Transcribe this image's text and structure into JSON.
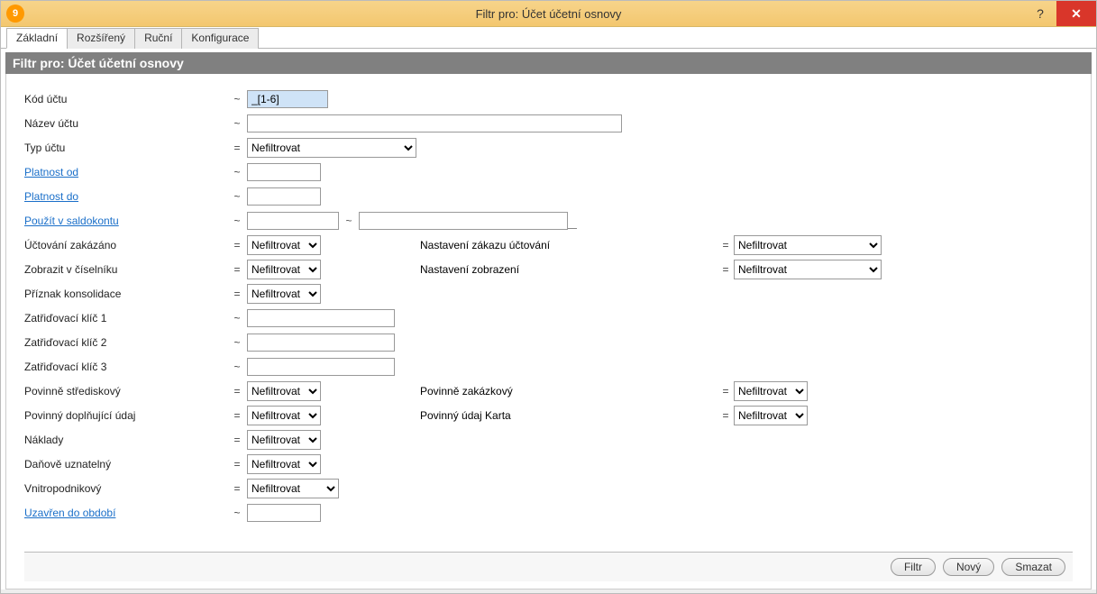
{
  "window": {
    "title": "Filtr pro: Účet účetní osnovy",
    "icon_char": "9"
  },
  "tabs": [
    "Základní",
    "Rozšířený",
    "Ruční",
    "Konfigurace"
  ],
  "active_tab": 0,
  "panel_title": "Filtr pro: Účet účetní osnovy",
  "ops": {
    "like": "~",
    "eq": "="
  },
  "rows": {
    "kod_uctu": {
      "label": "Kód účtu",
      "op": "~",
      "value": "_[1-6]"
    },
    "nazev_uctu": {
      "label": "Název účtu",
      "op": "~",
      "value": ""
    },
    "typ_uctu": {
      "label": "Typ účtu",
      "op": "=",
      "value": "Nefiltrovat"
    },
    "platnost_od": {
      "label": "Platnost od",
      "op": "~",
      "value": ""
    },
    "platnost_do": {
      "label": "Platnost do",
      "op": "~",
      "value": ""
    },
    "pouzit_v_saldokontu": {
      "label": "Použít v saldokontu",
      "op": "~",
      "v1": "",
      "sep": "~",
      "v2": ""
    },
    "uctovani_zakazano": {
      "label": "Účtování zakázáno",
      "op": "=",
      "value": "Nefiltrovat",
      "label2": "Nastavení zákazu účtování",
      "op2": "=",
      "value2": "Nefiltrovat"
    },
    "zobrazit_v_ciselniku": {
      "label": "Zobrazit v číselníku",
      "op": "=",
      "value": "Nefiltrovat",
      "label2": "Nastavení zobrazení",
      "op2": "=",
      "value2": "Nefiltrovat"
    },
    "priznak_konsolidace": {
      "label": "Příznak konsolidace",
      "op": "=",
      "value": "Nefiltrovat"
    },
    "zat1": {
      "label": "Zatřiďovací klíč 1",
      "op": "~",
      "value": ""
    },
    "zat2": {
      "label": "Zatřiďovací klíč 2",
      "op": "~",
      "value": ""
    },
    "zat3": {
      "label": "Zatřiďovací klíč 3",
      "op": "~",
      "value": ""
    },
    "pov_strediskovy": {
      "label": "Povinně střediskový",
      "op": "=",
      "value": "Nefiltrovat",
      "label2": "Povinně zakázkový",
      "op2": "=",
      "value2": "Nefiltrovat"
    },
    "pov_doplnujici": {
      "label": "Povinný doplňující údaj",
      "op": "=",
      "value": "Nefiltrovat",
      "label2": "Povinný údaj Karta",
      "op2": "=",
      "value2": "Nefiltrovat"
    },
    "naklady": {
      "label": "Náklady",
      "op": "=",
      "value": "Nefiltrovat"
    },
    "danove_uznatelny": {
      "label": "Daňově uznatelný",
      "op": "=",
      "value": "Nefiltrovat"
    },
    "vnitropodnikovy": {
      "label": "Vnitropodnikový",
      "op": "=",
      "value": "Nefiltrovat"
    },
    "uzavren_do_obdobi": {
      "label": "Uzavřen do období",
      "op": "~",
      "value": ""
    }
  },
  "buttons": {
    "filtr": "Filtr",
    "novy": "Nový",
    "smazat": "Smazat"
  }
}
